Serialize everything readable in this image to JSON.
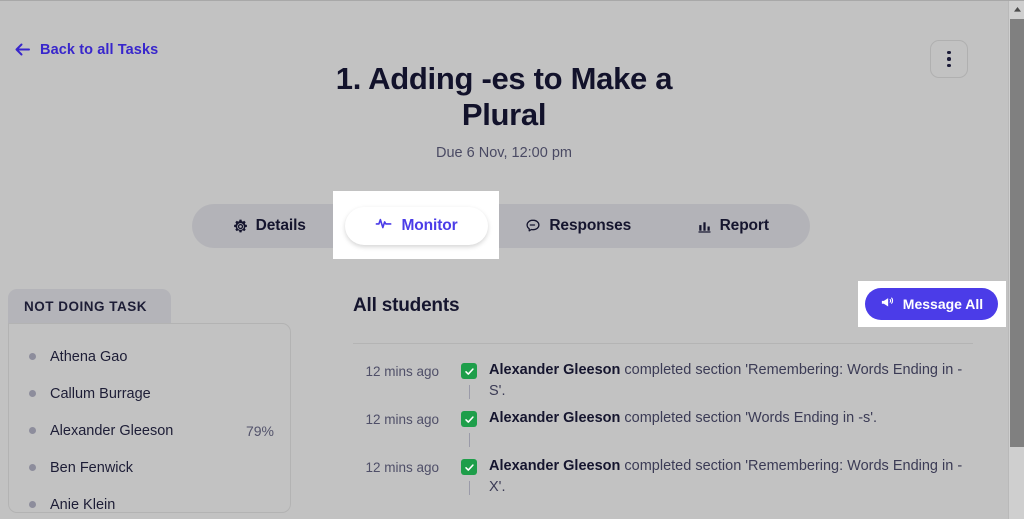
{
  "topbar": {
    "back_label": "Back to all Tasks",
    "back_icon": "arrow-left-icon",
    "menu_icon": "kebab-menu-icon"
  },
  "header": {
    "title": "1. Adding -es to Make a Plural",
    "due": "Due 6 Nov, 12:00 pm"
  },
  "tabs": [
    {
      "label": "Details",
      "icon": "gear-icon",
      "active": false
    },
    {
      "label": "Monitor",
      "icon": "activity-icon",
      "active": true
    },
    {
      "label": "Responses",
      "icon": "speech-bubble-icon",
      "active": false
    },
    {
      "label": "Report",
      "icon": "bar-chart-icon",
      "active": false
    }
  ],
  "sidebar": {
    "tab_label": "NOT DOING TASK",
    "students": [
      {
        "name": "Athena Gao",
        "percent": ""
      },
      {
        "name": "Callum Burrage",
        "percent": ""
      },
      {
        "name": "Alexander Gleeson",
        "percent": "79%"
      },
      {
        "name": "Ben Fenwick",
        "percent": ""
      },
      {
        "name": "Anie Klein",
        "percent": ""
      }
    ]
  },
  "main": {
    "title": "All students",
    "message_all_label": "Message All",
    "message_all_icon": "megaphone-icon",
    "activity": [
      {
        "time": "12 mins ago",
        "status_icon": "check-square-icon",
        "actor": "Alexander Gleeson",
        "text": " completed section 'Remembering: Words Ending in -S'."
      },
      {
        "time": "12 mins ago",
        "status_icon": "check-square-icon",
        "actor": "Alexander Gleeson",
        "text": " completed section 'Words Ending in -s'."
      },
      {
        "time": "12 mins ago",
        "status_icon": "check-square-icon",
        "actor": "Alexander Gleeson",
        "text": " completed section 'Remembering: Words Ending in -X'."
      }
    ]
  },
  "colors": {
    "accent": "#4b3ce8",
    "link": "#3826cc",
    "success": "#1e9e4a",
    "background": "#c2c2c2",
    "text_dark": "#15152e"
  }
}
